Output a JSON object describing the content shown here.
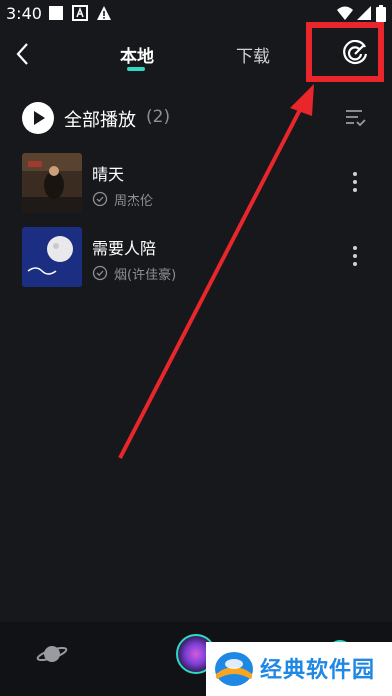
{
  "status_bar": {
    "time": "3:40"
  },
  "nav": {
    "tabs": [
      {
        "label": "本地"
      },
      {
        "label": "下载"
      }
    ]
  },
  "play_all": {
    "label": "全部播放",
    "count": "(2)"
  },
  "songs": [
    {
      "title": "晴天",
      "artist": "周杰伦"
    },
    {
      "title": "需要人陪",
      "artist": "烟(许佳豪)"
    }
  ],
  "watermark": {
    "text": "经典软件园"
  },
  "colors": {
    "accent": "#2fd9c2",
    "highlight": "#e8262b",
    "background": "#17181c"
  }
}
